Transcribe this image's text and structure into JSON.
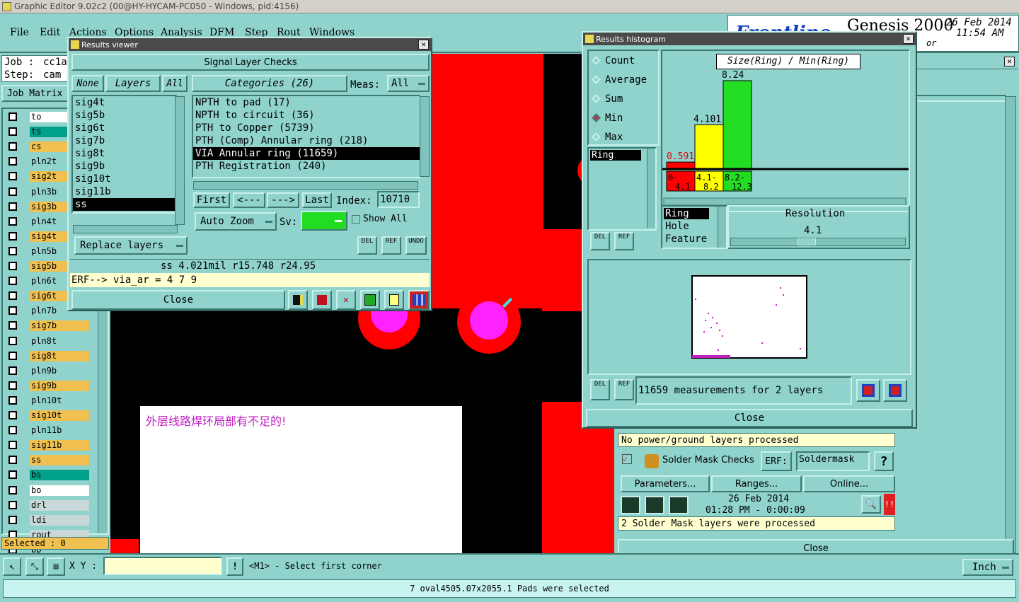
{
  "app": {
    "title": "Graphic Editor 9.02c2 (00@HY-HYCAM-PC050 - Windows, pid:4156)"
  },
  "menu": [
    "File",
    "Edit",
    "Actions",
    "Options",
    "Analysis",
    "DFM",
    "Step",
    "Rout",
    "Windows"
  ],
  "brand": {
    "name": "Genesis 2000",
    "date": "26 Feb 2014",
    "time": "11:54 AM",
    "logo_partial": "Frontline",
    "sub": "or"
  },
  "job": {
    "job_label": "Job :",
    "job_value": "cc1a",
    "step_label": "Step:",
    "step_value": "cam",
    "matrix_button": "Job Matrix"
  },
  "layers": [
    {
      "name": "to",
      "color": "#ffffff"
    },
    {
      "name": "ts",
      "color": "#00a08a"
    },
    {
      "name": "cs",
      "color": "#f0c050"
    },
    {
      "name": "pln2t",
      "color": "#8fd3cc"
    },
    {
      "name": "sig2t",
      "color": "#f0c050"
    },
    {
      "name": "pln3b",
      "color": "#8fd3cc"
    },
    {
      "name": "sig3b",
      "color": "#f0c050"
    },
    {
      "name": "pln4t",
      "color": "#8fd3cc"
    },
    {
      "name": "sig4t",
      "color": "#f0c050"
    },
    {
      "name": "pln5b",
      "color": "#8fd3cc"
    },
    {
      "name": "sig5b",
      "color": "#f0c050"
    },
    {
      "name": "pln6t",
      "color": "#8fd3cc"
    },
    {
      "name": "sig6t",
      "color": "#f0c050"
    },
    {
      "name": "pln7b",
      "color": "#8fd3cc"
    },
    {
      "name": "sig7b",
      "color": "#f0c050"
    },
    {
      "name": "pln8t",
      "color": "#8fd3cc"
    },
    {
      "name": "sig8t",
      "color": "#f0c050"
    },
    {
      "name": "pln9b",
      "color": "#8fd3cc"
    },
    {
      "name": "sig9b",
      "color": "#f0c050"
    },
    {
      "name": "pln10t",
      "color": "#8fd3cc"
    },
    {
      "name": "sig10t",
      "color": "#f0c050"
    },
    {
      "name": "pln11b",
      "color": "#8fd3cc"
    },
    {
      "name": "sig11b",
      "color": "#f0c050"
    },
    {
      "name": "ss",
      "color": "#f0c050"
    },
    {
      "name": "bs",
      "color": "#00a08a"
    },
    {
      "name": "bo",
      "color": "#ffffff"
    },
    {
      "name": "drl",
      "color": "#c8d8d8"
    },
    {
      "name": "ldi",
      "color": "#c8d8d8"
    },
    {
      "name": "rout",
      "color": "#c8d8d8"
    },
    {
      "name": "bp",
      "color": "#8fd3cc"
    }
  ],
  "selected_label": "Selected : 0",
  "results_viewer": {
    "title": "Results viewer",
    "header": "Signal Layer Checks",
    "none_btn": "None",
    "layers_label": "Layers",
    "all_btn": "All",
    "categories_label": "Categories (26)",
    "meas_label": "Meas:",
    "meas_value": "All",
    "layer_list": [
      "sig4t",
      "sig5b",
      "sig6t",
      "sig7b",
      "sig8t",
      "sig9b",
      "sig10t",
      "sig11b",
      "ss"
    ],
    "category_list": [
      "NPTH to pad (17)",
      "NPTH to circuit (36)",
      "PTH to Copper (5739)",
      "PTH (Comp) Annular ring (218)",
      "VIA Annular ring (11659)",
      "PTH Registration (240)"
    ],
    "first": "First",
    "prev": "<---",
    "next": "--->",
    "last": "Last",
    "index_label": "Index:",
    "index_value": "10710",
    "auto_zoom": "Auto Zoom",
    "sv_label": "Sv:",
    "show_all": "Show All",
    "replace_layers": "Replace layers",
    "del": "DEL",
    "ref": "REF",
    "undo": "UNDO",
    "measure_text": "ss 4.021mil  r15.748  r24.95",
    "erf_text": "ERF--> via_ar = 4 7 9",
    "close": "Close"
  },
  "histogram": {
    "title": "Results histogram",
    "options": [
      "Count",
      "Average",
      "Sum",
      "Min",
      "Max"
    ],
    "selected_option": "Min",
    "chart_title": "Size(Ring) / Min(Ring)",
    "list_item": "Ring",
    "types": [
      "Ring",
      "Hole",
      "Feature"
    ],
    "resolution_label": "Resolution",
    "resolution_value": "4.1",
    "measurements": "11659 measurements for 2 layers",
    "close": "Close",
    "del": "DEL",
    "ref": "REF"
  },
  "chart_data": {
    "type": "bar",
    "title": "Size(Ring) / Min(Ring)",
    "categories": [
      "0-4.1",
      "4.1-8.2",
      "8.2-12.3"
    ],
    "values": [
      0.591,
      4.101,
      8.24
    ],
    "colors": [
      "#ff0000",
      "#ffff00",
      "#22dd22"
    ],
    "value_labels": [
      "0.591",
      "4.101",
      "8.24"
    ],
    "cat_labels_top": [
      "0-",
      "4.1-",
      "8.2-"
    ],
    "cat_labels_bottom": [
      "4.1",
      "8.2",
      "12.3"
    ]
  },
  "checklist": {
    "no_power": "No power/ground layers processed",
    "solder_mask_title": "Solder Mask Checks",
    "erf_label": "ERF:",
    "erf_value": "Soldermask",
    "params": "Parameters...",
    "ranges": "Ranges...",
    "online": "Online...",
    "date": "26 Feb 2014",
    "time": "01:28 PM - 0:00:09",
    "processed": "2 Solder Mask layers were processed",
    "close": "Close"
  },
  "annotation": "外层线路焊环局部有不足的!",
  "bottom": {
    "xy_label": "X Y :",
    "prompt": "<M1> - Select first corner",
    "units": "Inch",
    "status": "7 oval4505.07x2055.1 Pads were selected"
  }
}
